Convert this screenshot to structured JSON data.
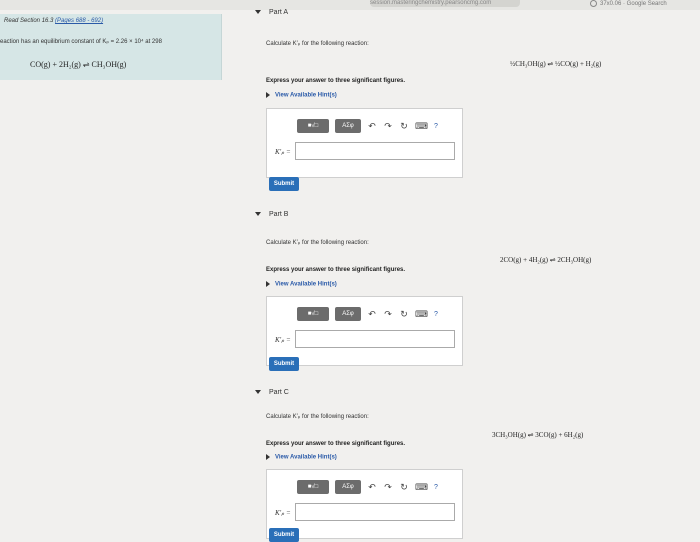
{
  "browser": {
    "url_fragment": "session.masteringchemistry.pearsoncmg.com",
    "status_right": "37x0.06 · Google Search"
  },
  "left_panel": {
    "read_prefix": "Read Section 16.3 ",
    "read_pages": "(Pages 688 - 692)",
    "description": "eaction has an equilibrium constant of Kₚ = 2.26 × 10⁴ at 298",
    "equation": "CO(g) + 2H₂(g) ⇌ CH₃OH(g)"
  },
  "parts": [
    {
      "header": "Part A",
      "calc_text": "Calculate K′ₚ for the following reaction:",
      "reaction": "½CH₃OH(g) ⇌ ½CO(g) + H₂(g)",
      "express": "Express your answer to three significant figures.",
      "hints": "View Available Hint(s)",
      "k_label": "K′ₚ =",
      "submit": "Submit"
    },
    {
      "header": "Part B",
      "calc_text": "Calculate K′ₚ for the following reaction:",
      "reaction": "2CO(g) + 4H₂(g) ⇌ 2CH₃OH(g)",
      "express": "Express your answer to three significant figures.",
      "hints": "View Available Hint(s)",
      "k_label": "K′ₚ =",
      "submit": "Submit"
    },
    {
      "header": "Part C",
      "calc_text": "Calculate K′ₚ for the following reaction:",
      "reaction": "3CH₃OH(g) ⇌ 3CO(g) + 6H₂(g)",
      "express": "Express your answer to three significant figures.",
      "hints": "View Available Hint(s)",
      "k_label": "K′ₚ =",
      "submit": "Submit"
    }
  ],
  "toolbar": {
    "templates_label": "■√□",
    "greek_label": "AΣφ",
    "undo_icon": "↶",
    "redo_icon": "↷",
    "reset_icon": "↻",
    "keyboard_icon": "⌨",
    "help_label": "?"
  }
}
